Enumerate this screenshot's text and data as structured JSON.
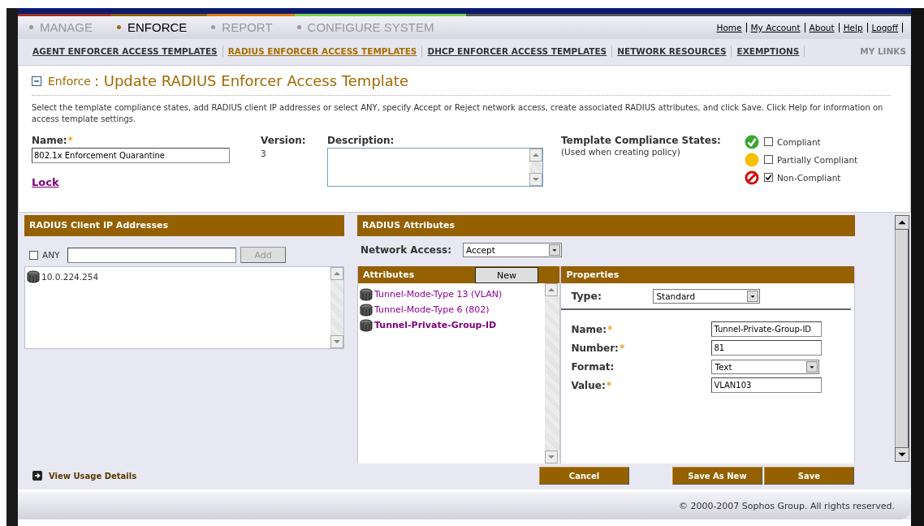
{
  "main_tabs": [
    {
      "label": "MANAGE",
      "selected": false
    },
    {
      "label": "ENFORCE",
      "selected": true
    },
    {
      "label": "REPORT",
      "selected": false
    },
    {
      "label": "CONFIGURE SYSTEM",
      "selected": false
    }
  ],
  "top_links": [
    "Home",
    "My Account",
    "About",
    "Help",
    "Logoff"
  ],
  "sub_tabs": [
    {
      "label": "AGENT ENFORCER ACCESS TEMPLATES",
      "selected": false
    },
    {
      "label": "RADIUS ENFORCER ACCESS TEMPLATES",
      "selected": true
    },
    {
      "label": "DHCP ENFORCER ACCESS TEMPLATES",
      "selected": false
    },
    {
      "label": "NETWORK RESOURCES",
      "selected": false
    },
    {
      "label": "EXEMPTIONS",
      "selected": false
    }
  ],
  "my_links": "MY LINKS",
  "header": {
    "section": "Enforce",
    "title": ": Update RADIUS Enforcer Access Template",
    "expanded": true,
    "instructions": "Select the template compliance states, add RADIUS client IP addresses or select ANY, specify Accept or Reject network access, create associated RADIUS attributes, and click Save. Click Help for information on access template settings.",
    "name": {
      "label": "Name:",
      "required_mark": "*",
      "value": "802.1x Enforcement Quarantine"
    },
    "version": {
      "label": "Version:",
      "value": "3"
    },
    "description": {
      "label": "Description:"
    },
    "lock": "Lock",
    "compliance": {
      "title": "Template Compliance States:",
      "subtitle": "(Used when creating policy)",
      "states": [
        {
          "kind": "compliant",
          "label": "Compliant",
          "checked": false
        },
        {
          "kind": "partial",
          "label": "Partially Compliant",
          "checked": false
        },
        {
          "kind": "non",
          "label": "Non-Compliant",
          "checked": true
        }
      ]
    }
  },
  "client_ip": {
    "title": "RADIUS Client IP Addresses",
    "any": {
      "label": "ANY",
      "checked": false
    },
    "add_button": {
      "label": "Add",
      "disabled": true
    },
    "entries": [
      "10.0.224.254"
    ]
  },
  "attributes": {
    "title": "RADIUS Attributes",
    "network_access": {
      "label": "Network Access:",
      "value": "Accept"
    },
    "list_title": "Attributes",
    "new_button": "New",
    "items": [
      {
        "label": "Tunnel-Mode-Type 13 (VLAN)",
        "selected": false
      },
      {
        "label": "Tunnel-Mode-Type 6 (802)",
        "selected": false
      },
      {
        "label": "Tunnel-Private-Group-ID",
        "selected": true
      }
    ]
  },
  "properties": {
    "title": "Properties",
    "type": {
      "label": "Type:",
      "value": "Standard"
    },
    "fields": [
      {
        "kind": "input",
        "label": "Name:",
        "required_mark": "*",
        "value": "Tunnel-Private-Group-ID"
      },
      {
        "kind": "input",
        "label": "Number:",
        "required_mark": "*",
        "value": "81"
      },
      {
        "kind": "select",
        "label": "Format:",
        "value": "Text"
      },
      {
        "kind": "input",
        "label": "Value:",
        "required_mark": "*",
        "value": "VLAN103"
      }
    ]
  },
  "view_usage": "View Usage Details",
  "buttons": [
    "Cancel",
    "Save As New",
    "Save"
  ],
  "footer": "© 2000-2007 Sophos Group. All rights reserved."
}
